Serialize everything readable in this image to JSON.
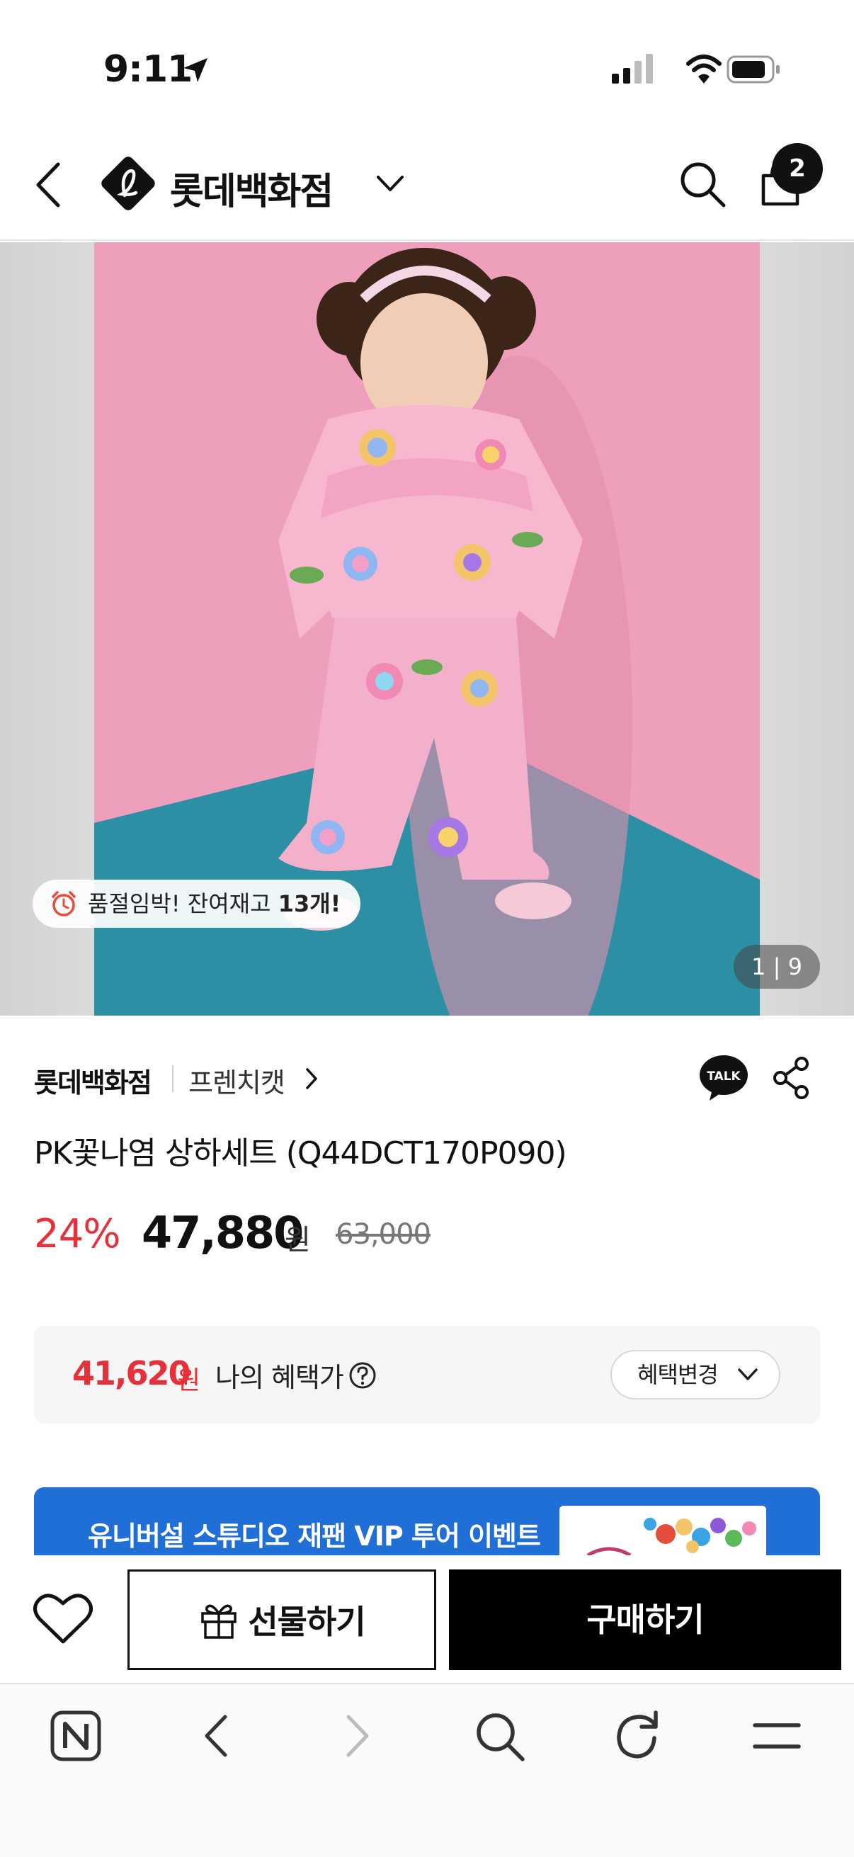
{
  "status_bar": {
    "time": "9:11"
  },
  "header": {
    "brand": "롯데백화점",
    "cart_count": "2"
  },
  "product_image": {
    "stock_prefix": "품절임박! 잔여재고 ",
    "stock_count": "13개!",
    "counter": "1 | 9"
  },
  "product": {
    "store": "롯데백화점",
    "brand_link": "프렌치캣",
    "title": "PK꽃나염 상하세트 (Q44DCT170P090)",
    "discount": "24%",
    "price": "47,880",
    "price_unit": "원",
    "original_price": "63,000"
  },
  "benefit": {
    "price": "41,620",
    "unit": "원",
    "label": "나의 혜택가",
    "change_label": "혜택변경"
  },
  "banner": {
    "text": "유니버설 스튜디오 재팬 VIP 투어 이벤트"
  },
  "actions": {
    "gift_label": "선물하기",
    "buy_label": "구매하기"
  },
  "colors": {
    "accent_red": "#e6303a",
    "banner_blue": "#1f6fd6"
  }
}
